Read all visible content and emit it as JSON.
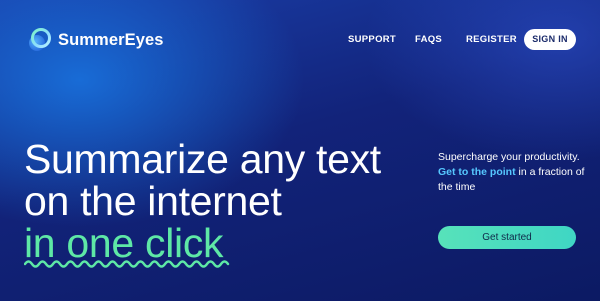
{
  "brand": {
    "name": "SummerEyes",
    "logo_icon": "lens-ring-icon",
    "accent_color": "#5ee8a6",
    "highlight_color": "#56c8ff"
  },
  "nav": {
    "items": [
      {
        "label": "SUPPORT"
      },
      {
        "label": "FAQS"
      },
      {
        "label": "REGISTER"
      }
    ],
    "signin_label": "SIGN IN"
  },
  "hero": {
    "headline_line1": "Summarize any text",
    "headline_line2": "on the internet",
    "headline_accent": "in one click",
    "tagline_part1": "Supercharge your productivity.",
    "tagline_highlight": "Get to the point",
    "tagline_part2": "in a fraction of the time",
    "cta_label": "Get started"
  }
}
